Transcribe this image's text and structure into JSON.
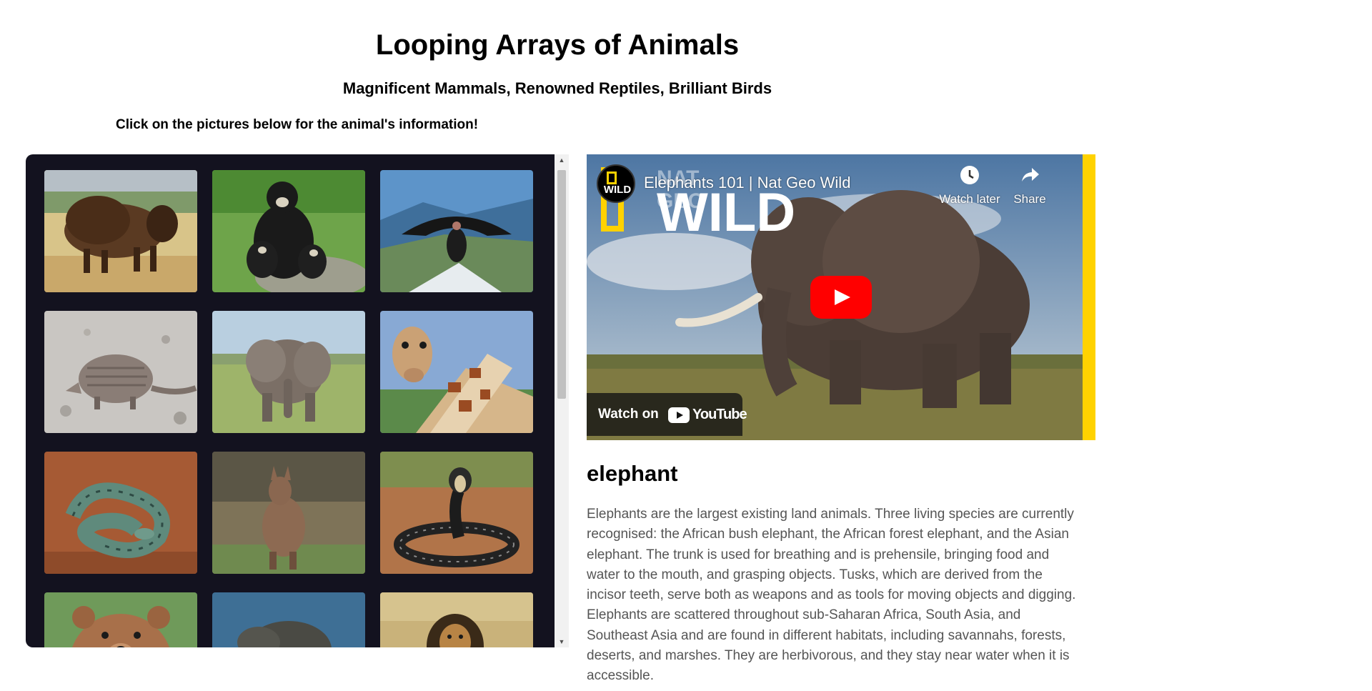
{
  "header": {
    "title": "Looping Arrays of Animals",
    "subtitle": "Magnificent Mammals, Renowned Reptiles, Brilliant Birds",
    "instructions": "Click on the pictures below for the animal's information!"
  },
  "gallery": {
    "animals": [
      {
        "name": "bison",
        "icon": "bison-photo"
      },
      {
        "name": "spectacled bear",
        "icon": "spectacled-bear-photo"
      },
      {
        "name": "condor",
        "icon": "condor-photo"
      },
      {
        "name": "armadillo",
        "icon": "armadillo-photo"
      },
      {
        "name": "elephant",
        "icon": "elephant-photo"
      },
      {
        "name": "giraffe",
        "icon": "giraffe-photo"
      },
      {
        "name": "anaconda",
        "icon": "anaconda-photo"
      },
      {
        "name": "kangaroo",
        "icon": "kangaroo-photo"
      },
      {
        "name": "cobra",
        "icon": "cobra-photo"
      },
      {
        "name": "brown bear",
        "icon": "brown-bear-photo"
      },
      {
        "name": "komodo dragon",
        "icon": "komodo-dragon-photo"
      },
      {
        "name": "lion",
        "icon": "lion-photo"
      }
    ]
  },
  "video": {
    "channel_wordmark": "NAT GEO",
    "channel_logo_text": "WILD",
    "title": "Elephants 101 | Nat Geo Wild",
    "watch_later_label": "Watch later",
    "share_label": "Share",
    "watch_on_label": "Watch on",
    "youtube_label": "YouTube",
    "accent_color": "#ffd200",
    "play_color": "#ff0000"
  },
  "selected": {
    "name": "elephant",
    "description": "Elephants are the largest existing land animals. Three living species are currently recognised: the African bush elephant, the African forest elephant, and the Asian elephant. The trunk is used for breathing and is prehensile, bringing food and water to the mouth, and grasping objects. Tusks, which are derived from the incisor teeth, serve both as weapons and as tools for moving objects and digging. Elephants are scattered throughout sub-Saharan Africa, South Asia, and Southeast Asia and are found in different habitats, including savannahs, forests, deserts, and marshes. They are herbivorous, and they stay near water when it is accessible."
  }
}
